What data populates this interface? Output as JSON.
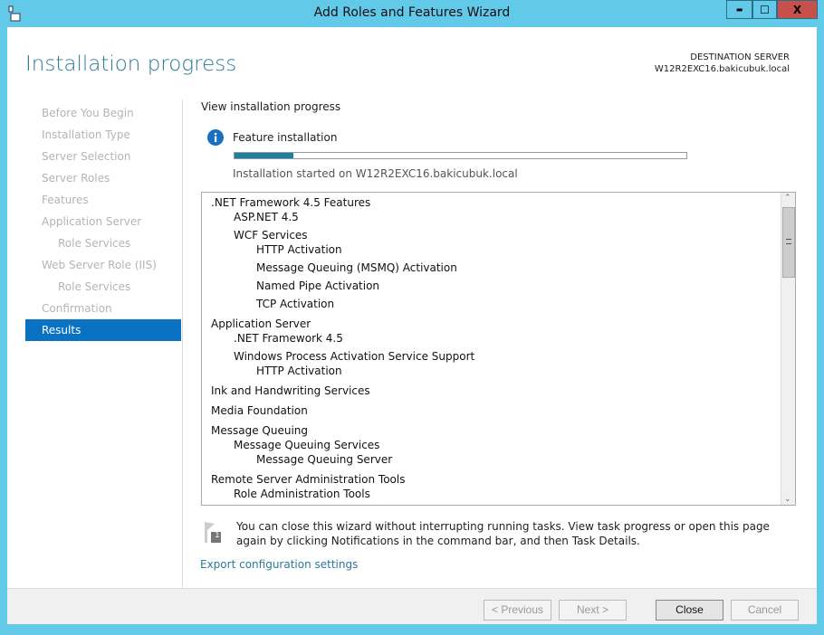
{
  "window": {
    "title": "Add Roles and Features Wizard",
    "minimize": "▬",
    "maximize": "☐",
    "close": "X"
  },
  "header": {
    "title": "Installation progress",
    "dest_label": "DESTINATION SERVER",
    "dest_server": "W12R2EXC16.bakicubuk.local"
  },
  "nav": [
    {
      "label": "Before You Begin"
    },
    {
      "label": "Installation Type"
    },
    {
      "label": "Server Selection"
    },
    {
      "label": "Server Roles"
    },
    {
      "label": "Features"
    },
    {
      "label": "Application Server"
    },
    {
      "label": "Role Services",
      "sub": true
    },
    {
      "label": "Web Server Role (IIS)"
    },
    {
      "label": "Role Services",
      "sub": true
    },
    {
      "label": "Confirmation"
    },
    {
      "label": "Results",
      "active": true
    }
  ],
  "main": {
    "view_label": "View installation progress",
    "status": "Feature installation",
    "progress_percent": 13,
    "started": "Installation started on W12R2EXC16.bakicubuk.local",
    "features": [
      {
        "t": ".NET Framework 4.5 Features",
        "l": 0
      },
      {
        "t": "ASP.NET 4.5",
        "l": 1
      },
      {
        "t": "WCF Services",
        "l": 1
      },
      {
        "t": "HTTP Activation",
        "l": 2
      },
      {
        "t": "Message Queuing (MSMQ) Activation",
        "l": 2
      },
      {
        "t": "Named Pipe Activation",
        "l": 2
      },
      {
        "t": "TCP Activation",
        "l": 2
      },
      {
        "t": "Application Server",
        "l": 0
      },
      {
        "t": ".NET Framework 4.5",
        "l": 1
      },
      {
        "t": "Windows Process Activation Service Support",
        "l": 1
      },
      {
        "t": "HTTP Activation",
        "l": 2
      },
      {
        "t": "Ink and Handwriting Services",
        "l": 0
      },
      {
        "t": "Media Foundation",
        "l": 0
      },
      {
        "t": "Message Queuing",
        "l": 0
      },
      {
        "t": "Message Queuing Services",
        "l": 1
      },
      {
        "t": "Message Queuing Server",
        "l": 2
      },
      {
        "t": "Remote Server Administration Tools",
        "l": 0
      },
      {
        "t": "Role Administration Tools",
        "l": 1
      }
    ],
    "note": "You can close this wizard without interrupting running tasks. View task progress or open this page again by clicking Notifications in the command bar, and then Task Details.",
    "note_badge": "1",
    "export_link": "Export configuration settings"
  },
  "footer": {
    "previous": "< Previous",
    "next": "Next >",
    "close": "Close",
    "cancel": "Cancel"
  },
  "colors": {
    "accent": "#0972c2",
    "titlebar": "#63c9e8",
    "close_btn": "#c7504b",
    "link": "#2b7b96"
  }
}
